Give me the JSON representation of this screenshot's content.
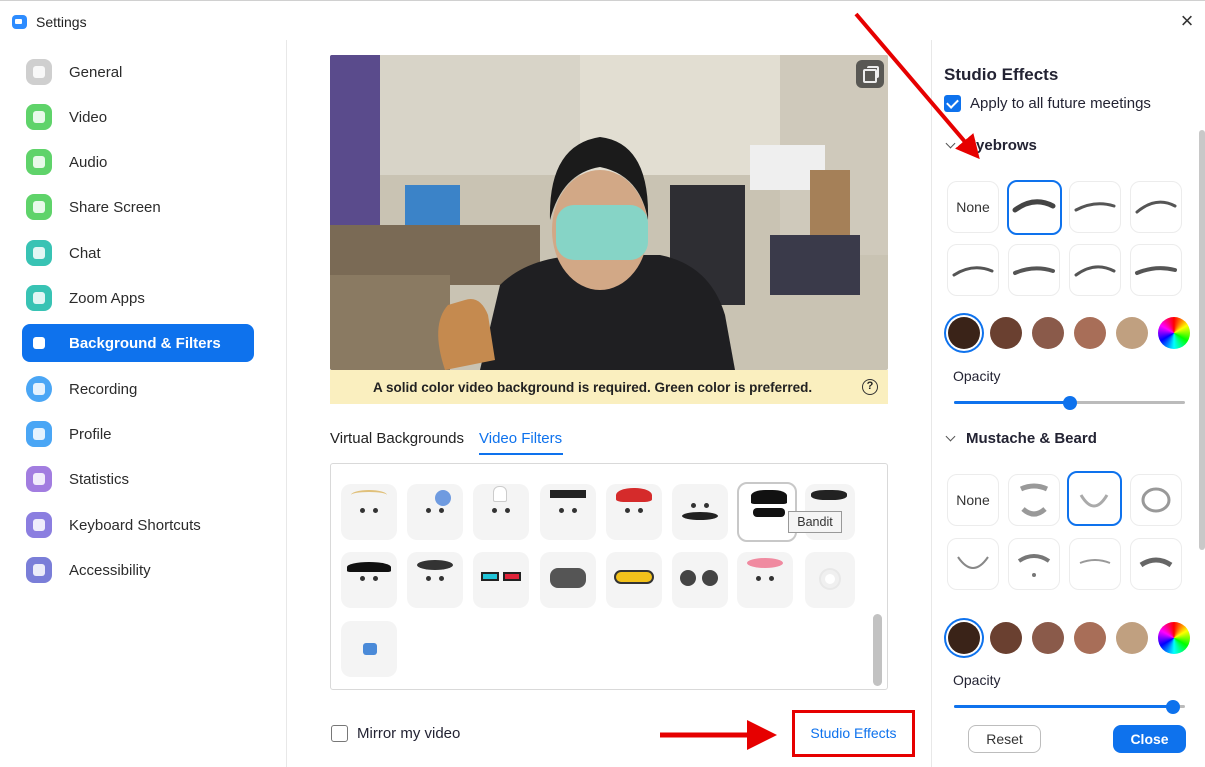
{
  "window": {
    "title": "Settings",
    "close_icon": "close-icon"
  },
  "sidebar": {
    "items": [
      {
        "label": "General",
        "icon": "gear-icon",
        "color": "#cfcfcf"
      },
      {
        "label": "Video",
        "icon": "video-camera-icon",
        "color": "#5fd36a"
      },
      {
        "label": "Audio",
        "icon": "headphones-icon",
        "color": "#5fd36a"
      },
      {
        "label": "Share Screen",
        "icon": "share-screen-icon",
        "color": "#5fd36a"
      },
      {
        "label": "Chat",
        "icon": "chat-bubble-icon",
        "color": "#38c3b4"
      },
      {
        "label": "Zoom Apps",
        "icon": "apps-icon",
        "color": "#38c3b4"
      },
      {
        "label": "Background & Filters",
        "icon": "portrait-icon",
        "color": "#0e72ed",
        "active": true
      },
      {
        "label": "Recording",
        "icon": "record-icon",
        "color": "#4aa6f5"
      },
      {
        "label": "Profile",
        "icon": "person-icon",
        "color": "#4aa6f5"
      },
      {
        "label": "Statistics",
        "icon": "bar-chart-icon",
        "color": "#a27de0"
      },
      {
        "label": "Keyboard Shortcuts",
        "icon": "keyboard-icon",
        "color": "#8b7ee0"
      },
      {
        "label": "Accessibility",
        "icon": "accessibility-icon",
        "color": "#7a7ed8"
      }
    ]
  },
  "preview": {
    "switch_camera_icon": "switch-camera-icon",
    "notice": "A solid color video background is required. Green color is preferred.",
    "help_symbol": "?"
  },
  "tabs": [
    {
      "label": "Virtual Backgrounds",
      "active": false
    },
    {
      "label": "Video Filters",
      "active": true
    }
  ],
  "filters": {
    "tooltip": "Bandit",
    "selected": "Bandit"
  },
  "footer": {
    "mirror_label": "Mirror my video",
    "mirror_checked": false,
    "studio_effects_link": "Studio Effects"
  },
  "studio_effects": {
    "title": "Studio Effects",
    "apply_label": "Apply to all future meetings",
    "apply_checked": true,
    "eyebrows": {
      "heading": "Eyebrows",
      "none_label": "None",
      "selected_index": 1,
      "opacity_label": "Opacity",
      "opacity": 0.5
    },
    "beard": {
      "heading": "Mustache & Beard",
      "none_label": "None",
      "selected_index": 2,
      "opacity_label": "Opacity",
      "opacity": 0.95
    },
    "colors": [
      "#3a2318",
      "#6a4030",
      "#8a5a4a",
      "#a86e58",
      "#c0a080",
      "rainbow"
    ],
    "reset_label": "Reset",
    "close_label": "Close"
  },
  "accent": "#0e72ed",
  "annotation_color": "#e60000"
}
